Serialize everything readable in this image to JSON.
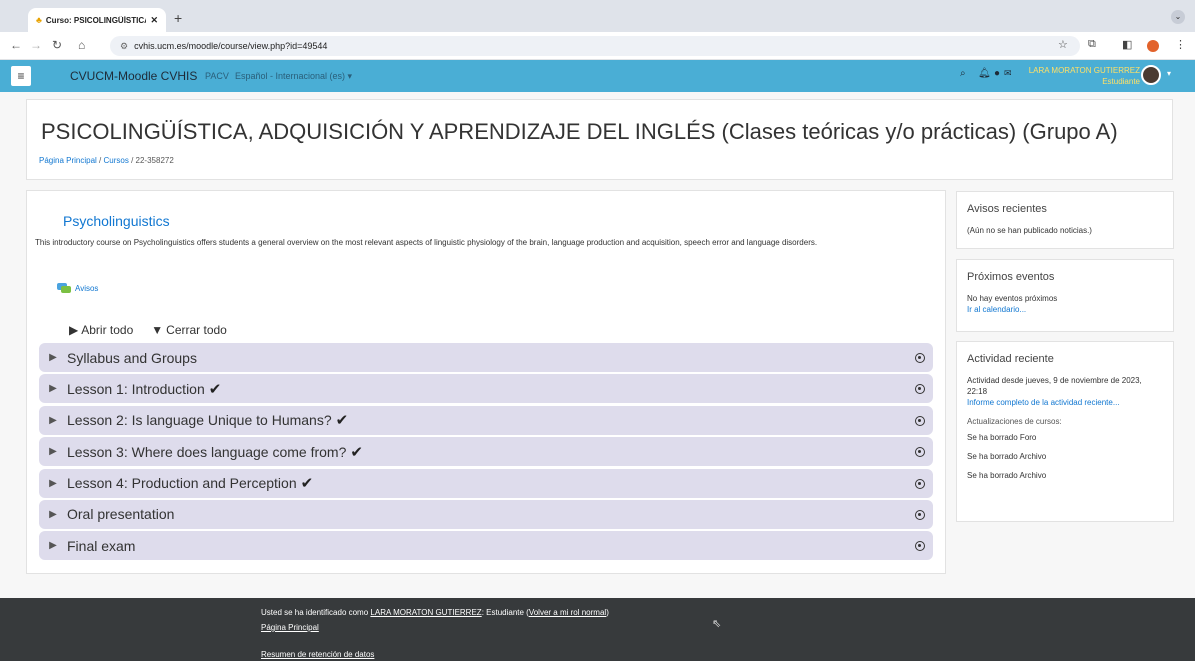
{
  "browser": {
    "tab_title": "Curso: PSICOLINGÜÍSTICA, ...",
    "tab_close": "✕",
    "new_tab": "+",
    "url": "cvhis.ucm.es/moodle/course/view.php?id=49544"
  },
  "navbar": {
    "brand": "CVUCM-Moodle CVHIS",
    "links": [
      "PACV",
      "Español - Internacional (es) ▾"
    ],
    "user_name": "LARA MORATON GUTIERREZ",
    "user_role": "Estudiante"
  },
  "header": {
    "title": "PSICOLINGÜÍSTICA, ADQUISICIÓN Y APRENDIZAJE DEL INGLÉS (Clases teóricas y/o prácticas) (Grupo A)",
    "breadcrumb": [
      "Página Principal",
      "Cursos",
      "22-358272"
    ]
  },
  "course": {
    "heading": "Psycholinguistics",
    "description": "This introductory course on Psycholinguistics offers students a general overview on the most relevant aspects of linguistic physiology of the brain, language production and acquisition, speech error and language disorders.",
    "forum_link": "Avisos",
    "expand_all": "Abrir todo",
    "collapse_all": "Cerrar todo",
    "sections": [
      {
        "name": "Syllabus and Groups",
        "done": ""
      },
      {
        "name": "Lesson 1: Introduction",
        "done": "✔"
      },
      {
        "name": "Lesson 2: Is language Unique to Humans?",
        "done": "✔"
      },
      {
        "name": "Lesson 3: Where does language come from?",
        "done": "✔"
      },
      {
        "name": "Lesson 4: Production and Perception",
        "done": "✔"
      },
      {
        "name": "Oral presentation",
        "done": ""
      },
      {
        "name": "Final exam",
        "done": ""
      }
    ]
  },
  "blocks": {
    "news": {
      "title": "Avisos recientes",
      "text": "(Aún no se han publicado noticias.)"
    },
    "events": {
      "title": "Próximos eventos",
      "text": "No hay eventos próximos",
      "link": "Ir al calendario..."
    },
    "activity": {
      "title": "Actividad reciente",
      "since": "Actividad desde jueves, 9 de noviembre de 2023, 22:18",
      "report_link": "Informe completo de la actividad reciente...",
      "updates_label": "Actualizaciones de cursos:",
      "items": [
        "Se ha borrado Foro",
        "Se ha borrado Archivo",
        "Se ha borrado Archivo"
      ]
    }
  },
  "footer": {
    "prefix": "Usted se ha identificado como",
    "user_link": "LARA MORATON GUTIERREZ",
    "role_text": ": Estudiante (",
    "return_link": "Volver a mi rol normal",
    "suffix": ")",
    "home_link": "Página Principal",
    "retention_link": "Resumen de retención de datos"
  }
}
